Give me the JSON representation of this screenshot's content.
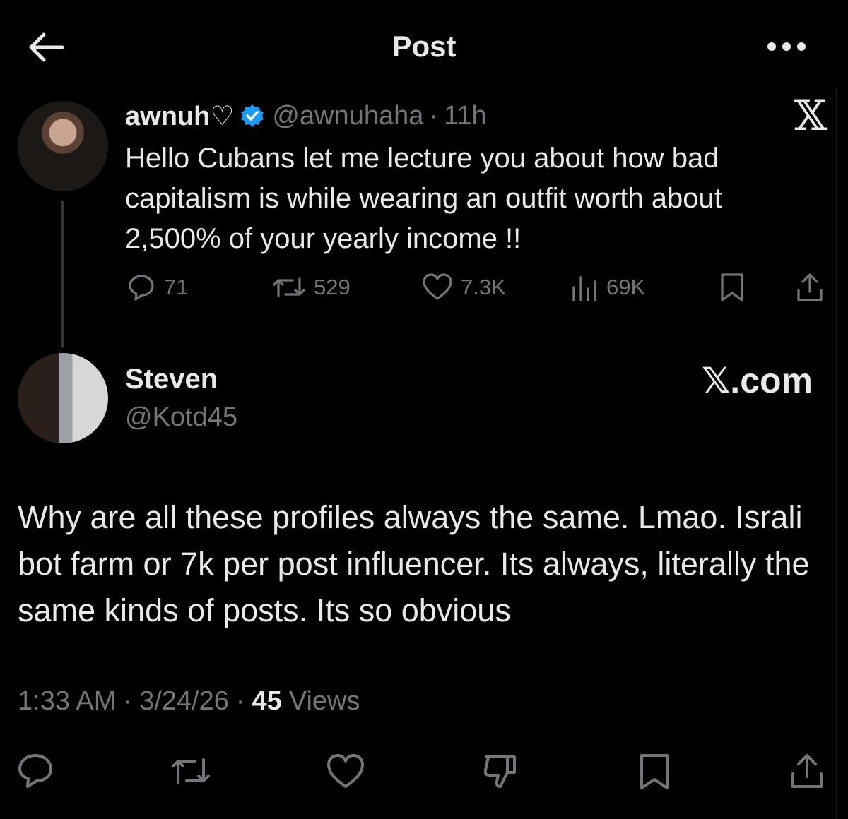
{
  "header": {
    "title": "Post",
    "back_icon": "arrow-left-icon",
    "more_icon": "more-horizontal-icon"
  },
  "quoted_post": {
    "display_name": "awnuh♡",
    "handle": "@awnuhaha",
    "separator": "·",
    "time": "11h",
    "verified": true,
    "watermark": "𝕏",
    "text": "Hello Cubans let me lecture you about how bad capitalism is while wearing an outfit worth about 2,500% of your yearly income !!",
    "stats": {
      "replies": "71",
      "reposts": "529",
      "likes": "7.3K",
      "views": "69K"
    }
  },
  "reply": {
    "display_name": "Steven",
    "handle": "@Kotd45",
    "watermark": "𝕏.com",
    "text": "Why are all these profiles always the same. Lmao. Israli bot farm or 7k per post influencer. Its always, literally the same kinds of posts. Its so obvious",
    "time": "1:33 AM",
    "date": "3/24/26",
    "separator": "·",
    "views_count": "45",
    "views_label": "Views"
  },
  "colors": {
    "background": "#000000",
    "text": "#e7e9ea",
    "secondary": "#71767b",
    "verified": "#1d9bf0"
  }
}
